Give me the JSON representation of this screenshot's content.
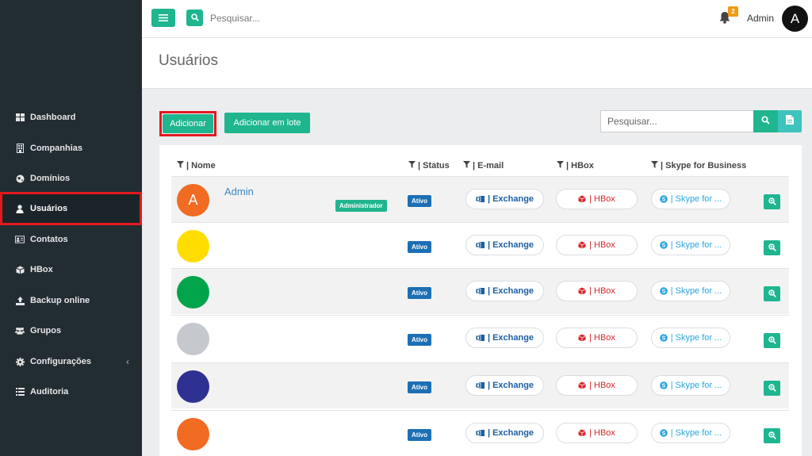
{
  "sidebar": {
    "items": [
      {
        "label": "Dashboard",
        "icon": "grid-icon"
      },
      {
        "label": "Companhias",
        "icon": "building-icon"
      },
      {
        "label": "Domínios",
        "icon": "globe-icon"
      },
      {
        "label": "Usuários",
        "icon": "user-icon"
      },
      {
        "label": "Contatos",
        "icon": "address-card-icon"
      },
      {
        "label": "HBox",
        "icon": "cube-icon"
      },
      {
        "label": "Backup online",
        "icon": "upload-icon"
      },
      {
        "label": "Grupos",
        "icon": "users-icon"
      },
      {
        "label": "Configurações",
        "icon": "gear-icon"
      },
      {
        "label": "Auditoria",
        "icon": "list-icon"
      }
    ],
    "active": "Usuários"
  },
  "topbar": {
    "search_placeholder": "Pesquisar...",
    "notification_count": "2",
    "user_name": "Admin",
    "user_initial": "A"
  },
  "page": {
    "title": "Usuários"
  },
  "toolbar": {
    "add_label": "Adicionar",
    "bulk_add_label": "Adicionar em lote",
    "search_placeholder": "Pesquisar..."
  },
  "table": {
    "headers": {
      "name": "| Nome",
      "status": "| Status",
      "email": "| E-mail",
      "hbox": "| HBox",
      "skype": "| Skype for Business"
    },
    "rows": [
      {
        "initial": "A",
        "name": "Admin",
        "role": "Administrador",
        "color": "#f26b22",
        "status": "Ativo",
        "exchange": "| Exchange",
        "hbox": "| HBox",
        "skype": "| Skype for ..."
      },
      {
        "initial": "",
        "name": "",
        "role": "",
        "color": "#ffdd00",
        "status": "Ativo",
        "exchange": "| Exchange",
        "hbox": "| HBox",
        "skype": "| Skype for ..."
      },
      {
        "initial": "",
        "name": "",
        "role": "",
        "color": "#00a54b",
        "status": "Ativo",
        "exchange": "| Exchange",
        "hbox": "| HBox",
        "skype": "| Skype for ..."
      },
      {
        "initial": "",
        "name": "",
        "role": "",
        "color": "#c5c8cc",
        "status": "Ativo",
        "exchange": "| Exchange",
        "hbox": "| HBox",
        "skype": "| Skype for ..."
      },
      {
        "initial": "",
        "name": "",
        "role": "",
        "color": "#2e3192",
        "status": "Ativo",
        "exchange": "| Exchange",
        "hbox": "| HBox",
        "skype": "| Skype for ..."
      },
      {
        "initial": "",
        "name": "",
        "role": "",
        "color": "#f26b22",
        "status": "Ativo",
        "exchange": "| Exchange",
        "hbox": "| HBox",
        "skype": "| Skype for ..."
      }
    ]
  },
  "colors": {
    "accent": "#1fb58f",
    "sidebar_bg": "#222d32",
    "highlight": "#e3191e",
    "status_blue": "#1d6fb3"
  }
}
